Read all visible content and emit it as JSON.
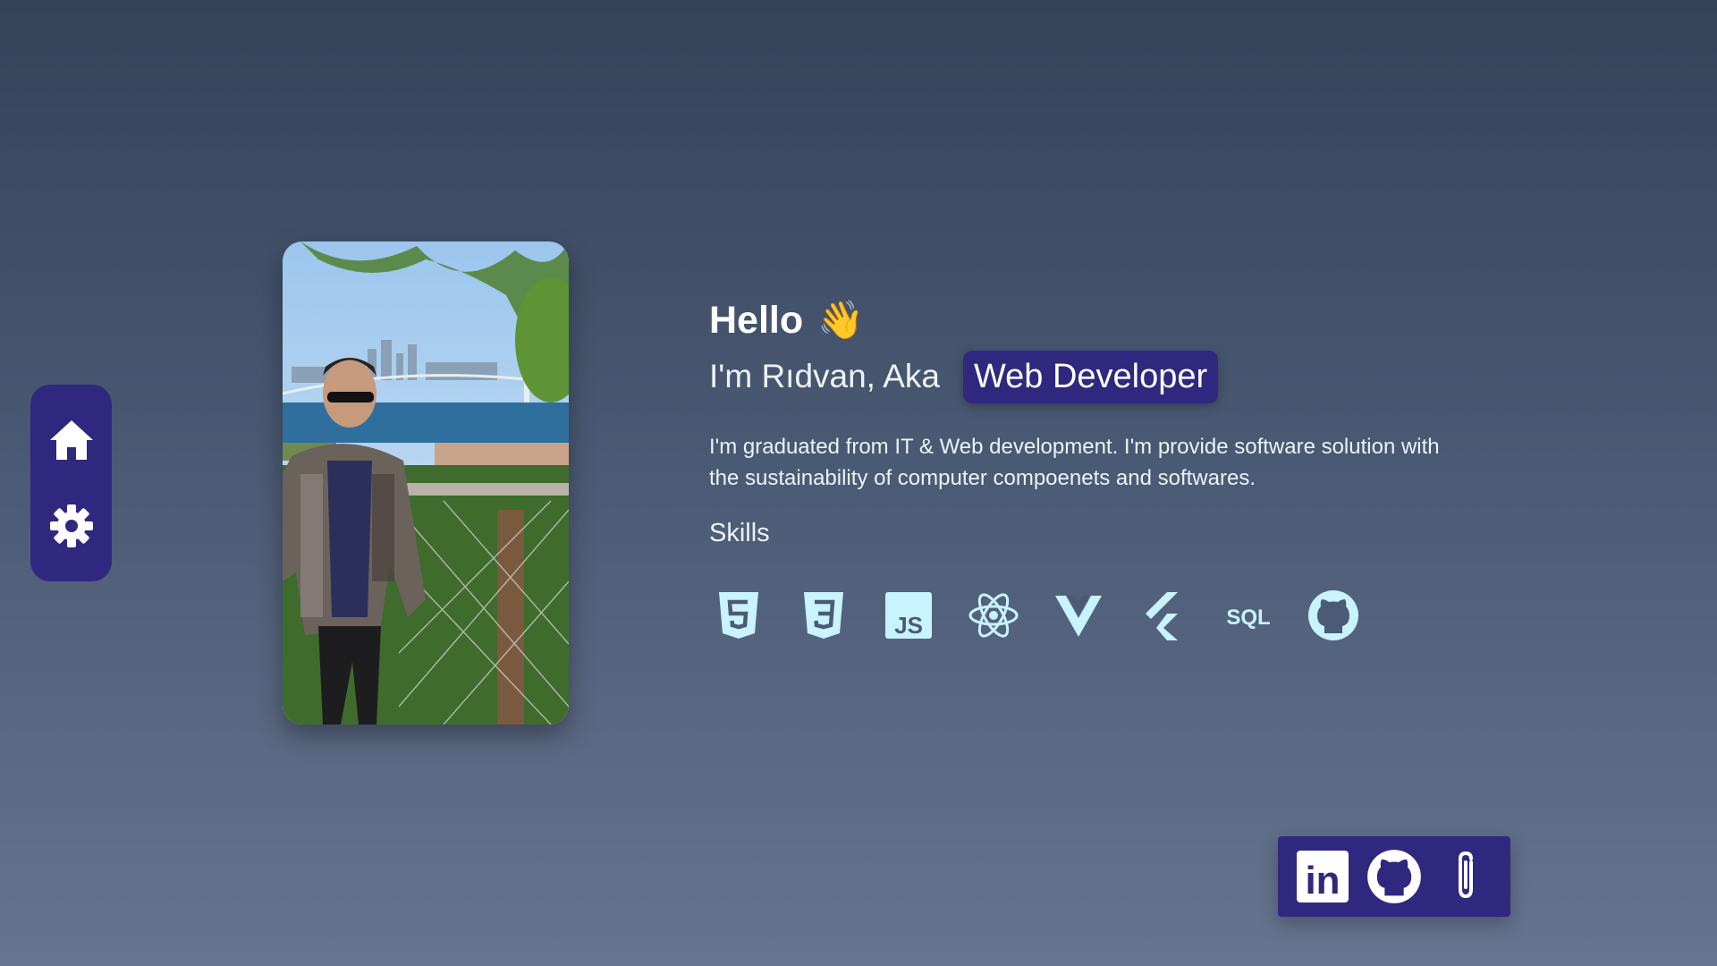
{
  "nav": {
    "items": [
      {
        "icon": "home-icon"
      },
      {
        "icon": "gear-icon"
      }
    ]
  },
  "profile": {
    "photo_subject": "man with sunglasses in front of Bosphorus bridge"
  },
  "intro": {
    "greeting": "Hello",
    "wave_emoji": "👋",
    "aka_text": "I'm Rıdvan, Aka",
    "role": "Web Developer",
    "description": "I'm graduated from IT & Web development. I'm provide software solution with the sustainability of computer compoenets and softwares.",
    "skills_title": "Skills",
    "skills": [
      {
        "icon": "html5-icon"
      },
      {
        "icon": "css3-icon"
      },
      {
        "icon": "javascript-icon",
        "text": "JS"
      },
      {
        "icon": "react-icon"
      },
      {
        "icon": "vue-icon"
      },
      {
        "icon": "flutter-icon"
      },
      {
        "icon": "sql-icon",
        "text": "SQL"
      },
      {
        "icon": "github-icon"
      }
    ]
  },
  "social": {
    "items": [
      {
        "icon": "linkedin-icon",
        "text": "in"
      },
      {
        "icon": "github-icon"
      },
      {
        "icon": "paperclip-icon"
      }
    ]
  },
  "colors": {
    "accent": "#30287e",
    "skill_icon": "#c8f3ff",
    "background_top": "#34425a",
    "background_bottom": "#66748f"
  }
}
